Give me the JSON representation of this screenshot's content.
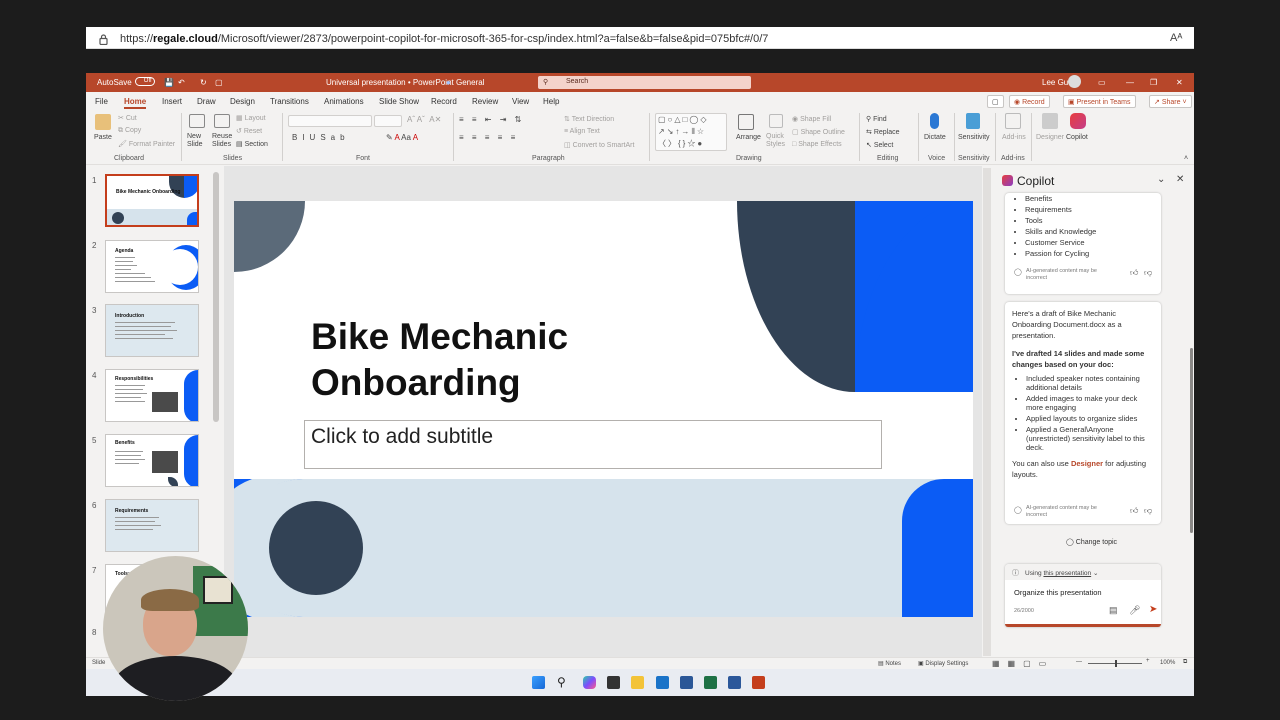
{
  "browser": {
    "url_prefix": "https://",
    "url_domain": "regale.cloud",
    "url_rest": "/Microsoft/viewer/2873/powerpoint-copilot-for-microsoft-365-for-csp/index.html?a=false&b=false&pid=075bfc#/0/7",
    "reader_icon": "Aᴬ"
  },
  "titlebar": {
    "autosave": "AutoSave",
    "autosave_state": "Off",
    "doc_title": "Universal presentation • PowerPoint",
    "sensitivity": "General",
    "search_placeholder": "Search",
    "user": "Lee Gu"
  },
  "menu": {
    "tabs": [
      "File",
      "Home",
      "Insert",
      "Draw",
      "Design",
      "Transitions",
      "Animations",
      "Slide Show",
      "Record",
      "Review",
      "View",
      "Help"
    ],
    "record_btn": "Record",
    "present_btn": "Present in Teams",
    "share_btn": "Share"
  },
  "ribbon": {
    "paste": "Paste",
    "cut": "Cut",
    "copy": "Copy",
    "format_painter": "Format Painter",
    "clipboard": "Clipboard",
    "new_slide": "New Slide",
    "reuse_slides": "Reuse Slides",
    "layout": "Layout",
    "reset": "Reset",
    "section": "Section",
    "slides": "Slides",
    "font": "Font",
    "text_direction": "Text Direction",
    "align_text": "Align Text",
    "convert_smartart": "Convert to SmartArt",
    "paragraph": "Paragraph",
    "arrange": "Arrange",
    "quick_styles": "Quick Styles",
    "shape_fill": "Shape Fill",
    "shape_outline": "Shape Outline",
    "shape_effects": "Shape Effects",
    "drawing": "Drawing",
    "find": "Find",
    "replace": "Replace",
    "select": "Select",
    "editing": "Editing",
    "dictate": "Dictate",
    "voice": "Voice",
    "sensitivity": "Sensitivity",
    "add_ins": "Add-ins",
    "designer": "Designer",
    "copilot": "Copilot"
  },
  "thumbnails": [
    {
      "num": "1",
      "title": "Bike Mechanic Onboarding"
    },
    {
      "num": "2",
      "title": "Agenda"
    },
    {
      "num": "3",
      "title": "Introduction"
    },
    {
      "num": "4",
      "title": "Responsibilities"
    },
    {
      "num": "5",
      "title": "Benefits"
    },
    {
      "num": "6",
      "title": "Requirements"
    },
    {
      "num": "7",
      "title": "Tools: B"
    },
    {
      "num": "8",
      "title": ""
    }
  ],
  "slide": {
    "title_line1": "Bike Mechanic",
    "title_line2": "Onboarding",
    "subtitle_placeholder": "Click to add subtitle"
  },
  "copilot": {
    "header": "Copilot",
    "list_items": [
      "Benefits",
      "Requirements",
      "Tools",
      "Skills and Knowledge",
      "Customer Service",
      "Passion for Cycling"
    ],
    "ai_note": "AI-generated content may be incorrect",
    "draft_intro": "Here's a draft of Bike Mechanic Onboarding Document.docx as a presentation.",
    "changes_heading": "I've drafted 14 slides and made some changes based on your doc:",
    "changes": [
      "Included speaker notes containing additional details",
      "Added images to make your deck more engaging",
      "Applied layouts to organize slides",
      "Applied a General\\Anyone (unrestricted) sensitivity label to this deck."
    ],
    "designer_pre": "You can also use ",
    "designer_link": "Designer",
    "designer_post": " for adjusting layouts.",
    "change_topic": "Change topic",
    "using_pre": "Using ",
    "using_link": "this presentation",
    "prompt_text": "Organize this presentation",
    "char_count": "26/2000"
  },
  "status": {
    "left": "Slide",
    "notes": "Notes",
    "display_settings": "Display Settings",
    "zoom": "100%"
  },
  "colors": {
    "brand": "#b7472a",
    "slide_blue": "#0b5cf5",
    "slide_navy": "#324255",
    "slide_gray": "#5b6a79",
    "slide_band": "#d6e3ec"
  }
}
